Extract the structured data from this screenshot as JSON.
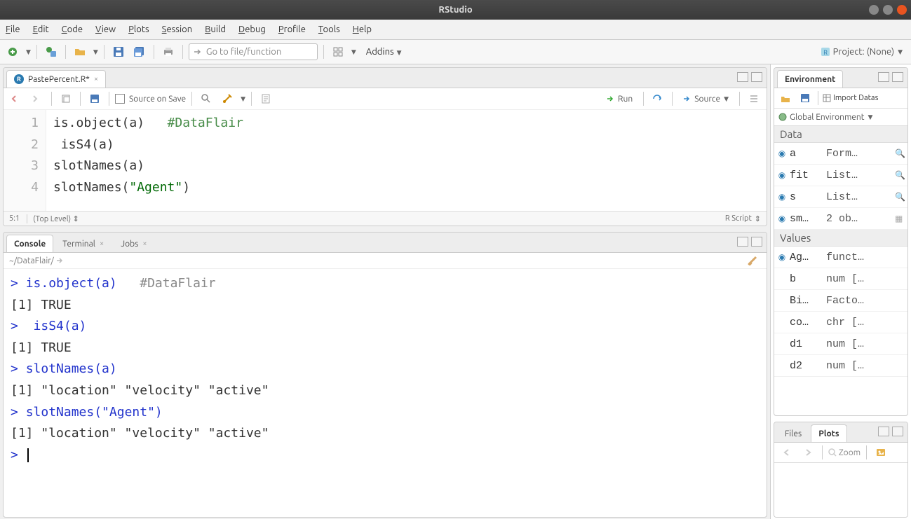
{
  "window": {
    "title": "RStudio"
  },
  "menubar": {
    "file": "File",
    "edit": "Edit",
    "code": "Code",
    "view": "View",
    "plots": "Plots",
    "session": "Session",
    "build": "Build",
    "debug": "Debug",
    "profile": "Profile",
    "tools": "Tools",
    "help": "Help"
  },
  "toolbar": {
    "goto_placeholder": "Go to file/function",
    "addins": "Addins",
    "project_label": "Project: (None)"
  },
  "editor": {
    "tab_title": "PastePercent.R*",
    "source_on_save": "Source on Save",
    "run": "Run",
    "source": "Source",
    "lines": [
      {
        "n": "1",
        "code": "is.object(a)",
        "comment": "#DataFlair"
      },
      {
        "n": "2",
        "code": " isS4(a)",
        "comment": ""
      },
      {
        "n": "3",
        "code": "slotNames(a)",
        "comment": ""
      },
      {
        "n": "4",
        "code": "slotNames(\"Agent\")",
        "comment": ""
      }
    ],
    "status_pos": "5:1",
    "status_scope": "(Top Level)",
    "status_type": "R Script"
  },
  "console": {
    "tabs": {
      "console": "Console",
      "terminal": "Terminal",
      "jobs": "Jobs"
    },
    "path": "~/DataFlair/",
    "lines": [
      {
        "type": "cmd",
        "text": "is.object(a)   #DataFlair"
      },
      {
        "type": "out",
        "text": "[1] TRUE"
      },
      {
        "type": "cmd",
        "text": " isS4(a)"
      },
      {
        "type": "out",
        "text": "[1] TRUE"
      },
      {
        "type": "cmd",
        "text": "slotNames(a)"
      },
      {
        "type": "out",
        "text": "[1] \"location\" \"velocity\" \"active\"  "
      },
      {
        "type": "cmd",
        "text": "slotNames(\"Agent\")"
      },
      {
        "type": "out",
        "text": "[1] \"location\" \"velocity\" \"active\"  "
      },
      {
        "type": "prompt",
        "text": ""
      }
    ]
  },
  "env": {
    "tab": "Environment",
    "import": "Import Datas",
    "scope": "Global Environment",
    "sections": [
      {
        "title": "Data",
        "rows": [
          {
            "ico": true,
            "name": "a",
            "val": "Form…",
            "mag": true
          },
          {
            "ico": true,
            "name": "fit",
            "val": "List…",
            "mag": true
          },
          {
            "ico": true,
            "name": "s",
            "val": "List…",
            "mag": true
          },
          {
            "ico": true,
            "name": "sm…",
            "val": "2 ob…",
            "mag": false,
            "grid": true
          }
        ]
      },
      {
        "title": "Values",
        "rows": [
          {
            "ico": true,
            "name": "Ag…",
            "val": "funct…"
          },
          {
            "ico": false,
            "name": "b",
            "val": "num […"
          },
          {
            "ico": false,
            "name": "Bi…",
            "val": "Facto…"
          },
          {
            "ico": false,
            "name": "co…",
            "val": "chr […"
          },
          {
            "ico": false,
            "name": "d1",
            "val": "num […"
          },
          {
            "ico": false,
            "name": "d2",
            "val": "num […"
          }
        ]
      }
    ]
  },
  "plots": {
    "tabs": {
      "files": "Files",
      "plots": "Plots"
    },
    "zoom": "Zoom"
  }
}
